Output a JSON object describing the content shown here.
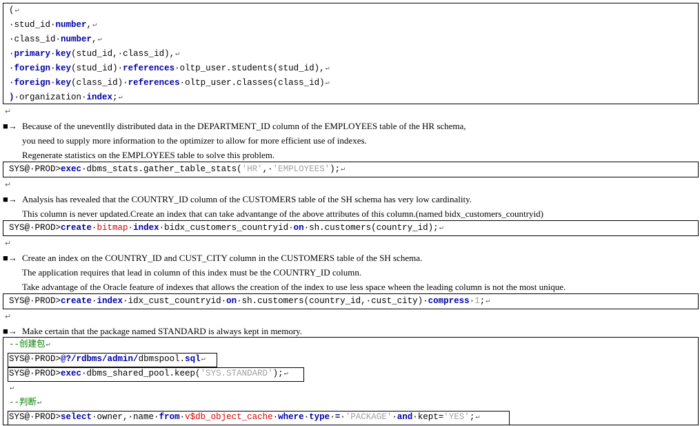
{
  "top_fragment": "...",
  "block1": {
    "lines": [
      "(",
      " stud_id number,",
      " class_id number,",
      " primary key(stud_id, class_id),",
      " foreign key(stud_id) references oltp_user.students(stud_id),",
      " foreign key(class_id) references oltp_user.classes(class_id)",
      ") organization index;"
    ]
  },
  "q1": {
    "lines": [
      "Because of the uneventlly distributed data in the DEPARTMENT_ID column of the EMPLOYEES table of the HR schema,",
      "you need to supply more information to the optimizer to allow for more efficient use of indexes.",
      "Regenerate statistics on the EMPLOYEES table to solve this problem."
    ],
    "prompt": "SYS@ PROD>",
    "code": "exec dbms_stats.gather_table_stats('HR', 'EMPLOYEES');"
  },
  "q2": {
    "lines": [
      "Analysis has revealed that the COUNTRY_ID column of the CUSTOMERS table of the SH schema has very low cardinality.",
      "This column is never updated.Create an index that can take advantange of the above attributes of this column.(named bidx_customers_countryid)"
    ],
    "prompt": "SYS@ PROD>",
    "code": "create bitmap index bidx_customers_countryid on sh.customers(country_id);"
  },
  "q3": {
    "lines": [
      "Create an index on the COUNTRY_ID and CUST_CITY column in the CUSTOMERS table of the SH schema.",
      "The application requires that lead in column of this index must be the COUNTRY_ID column.",
      "Take advantage of the Oracle feature of indexes that allows the creation of the index to use less space wheen the leading column is not the most unique."
    ],
    "prompt": "SYS@ PROD>",
    "code": "create index idx_cust_countryid on sh.customers(country_id, cust_city) compress 1;"
  },
  "q4": {
    "lines": [
      "Make certain that the package named STANDARD is always kept in memory."
    ],
    "comment1": "--创建包",
    "cmd1_prompt": "SYS@ PROD>",
    "cmd1": "@?/rdbms/admin/dbmspool.sql",
    "cmd2_prompt": "SYS@ PROD>",
    "cmd2": "exec dbms_shared_pool.keep('SYS.STANDARD');",
    "comment2": "--判断",
    "cmd3_prompt": "SYS@ PROD>",
    "cmd3": "select owner, name from v$db_object_cache where type = 'PACKAGE' and kept='YES';"
  }
}
